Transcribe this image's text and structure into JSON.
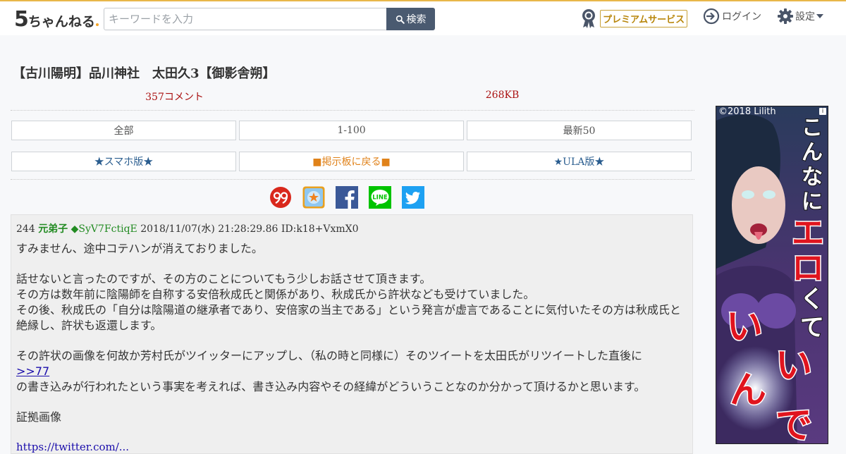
{
  "header": {
    "logo_main": "5",
    "logo_rest": "ちゃんねる",
    "search_placeholder": "キーワードを入力",
    "search_button": "検索",
    "premium_label": "プレミアムサービス",
    "login_label": "ログイン",
    "settings_label": "設定"
  },
  "thread": {
    "title": "【古川陽明】品川神社　太田久3【御影舎朔】",
    "comment_count": "357コメント",
    "size": "268KB"
  },
  "nav": {
    "row1": [
      "全部",
      "1-100",
      "最新50"
    ],
    "row2": [
      "★スマホ版★",
      "■掲示板に戻る■",
      "★ULA版★"
    ]
  },
  "share": {
    "icons": [
      "5ch-99-icon",
      "bookmark-icon",
      "facebook-icon",
      "line-icon",
      "twitter-icon"
    ],
    "line_text": "LINE"
  },
  "post": {
    "number": "244",
    "name": "元弟子",
    "trip": "◆SyV7FctiqE",
    "date": "2018/11/07(水) 21:28:29.86 ID:k18+VxmX0",
    "lines": [
      "すみません、途中コテハンが消えておりました。",
      "話せないと言ったのですが、その方のことについてもう少しお話させて頂きます。",
      "その方は数年前に陰陽師を自称する安倍秋成氏と関係があり、秋成氏から許状なども受けていました。",
      "その後、秋成氏の「自分は陰陽道の継承者であり、安倍家の当主である」という発言が虚言であることに気付いたその方は秋成氏と絶縁し、許状も返還します。",
      "その許状の画像を何故か芳村氏がツイッターにアップし、（私の時と同様に）そのツイートを太田氏がリツイートした直後に",
      "の書き込みが行われたという事実を考えれば、書き込み内容やその経緯がどういうことなのか分かって頂けるかと思います。",
      "証拠画像"
    ],
    "anchor": ">>77",
    "cut_link": "https://twitter.com/..."
  },
  "ad": {
    "copyright": "©2018 Lilith",
    "info": "i",
    "bg_color": "#3a2a55"
  },
  "colors": {
    "accent_line": "#e8b74a",
    "comment_red": "#aa1111",
    "name_green": "#228b22",
    "search_btn": "#4a5a70",
    "link_blue": "#1a0dab"
  }
}
